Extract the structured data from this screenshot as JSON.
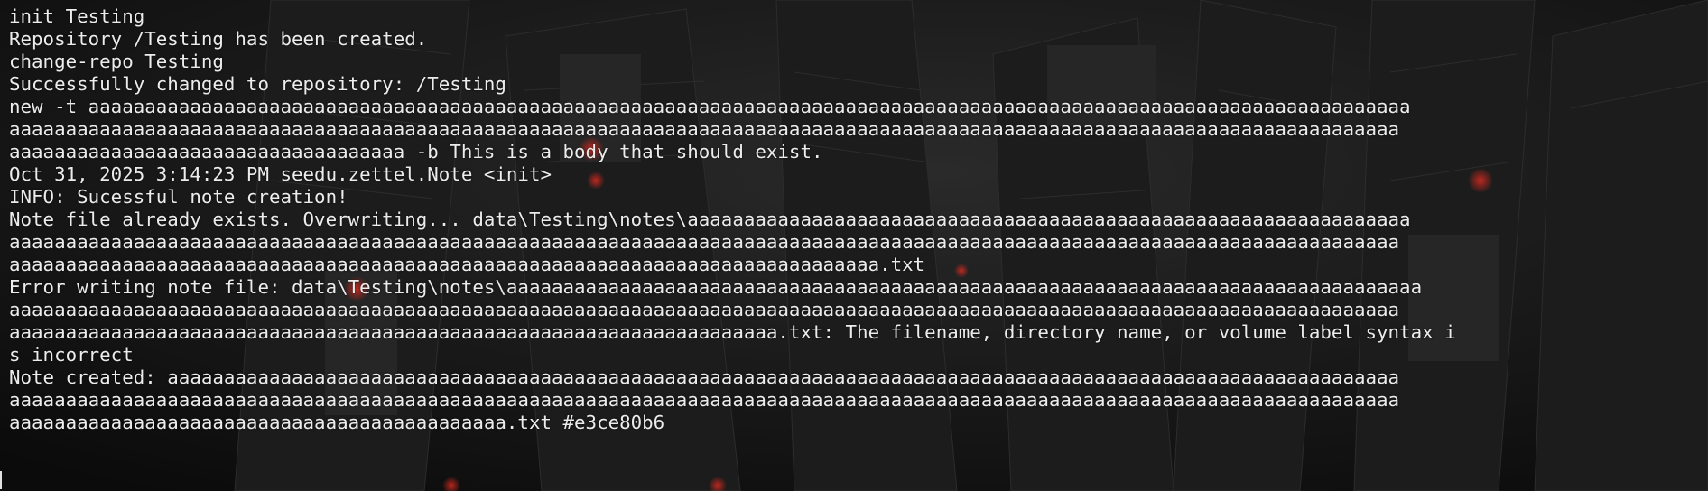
{
  "terminal": {
    "lines": [
      "init Testing",
      "Repository /Testing has been created.",
      "change-repo Testing",
      "Successfully changed to repository: /Testing",
      "new -t aaaaaaaaaaaaaaaaaaaaaaaaaaaaaaaaaaaaaaaaaaaaaaaaaaaaaaaaaaaaaaaaaaaaaaaaaaaaaaaaaaaaaaaaaaaaaaaaaaaaaaaaaaaaaaaaaaaaa",
      "aaaaaaaaaaaaaaaaaaaaaaaaaaaaaaaaaaaaaaaaaaaaaaaaaaaaaaaaaaaaaaaaaaaaaaaaaaaaaaaaaaaaaaaaaaaaaaaaaaaaaaaaaaaaaaaaaaaaaaaaaaa",
      "aaaaaaaaaaaaaaaaaaaaaaaaaaaaaaaaaaa -b This is a body that should exist.",
      "Oct 31, 2025 3:14:23 PM seedu.zettel.Note <init>",
      "INFO: Sucessful note creation!",
      "Note file already exists. Overwriting... data\\Testing\\notes\\aaaaaaaaaaaaaaaaaaaaaaaaaaaaaaaaaaaaaaaaaaaaaaaaaaaaaaaaaaaaaaaa",
      "aaaaaaaaaaaaaaaaaaaaaaaaaaaaaaaaaaaaaaaaaaaaaaaaaaaaaaaaaaaaaaaaaaaaaaaaaaaaaaaaaaaaaaaaaaaaaaaaaaaaaaaaaaaaaaaaaaaaaaaaaaa",
      "aaaaaaaaaaaaaaaaaaaaaaaaaaaaaaaaaaaaaaaaaaaaaaaaaaaaaaaaaaaaaaaaaaaaaaaaaaaaa.txt",
      "Error writing note file: data\\Testing\\notes\\aaaaaaaaaaaaaaaaaaaaaaaaaaaaaaaaaaaaaaaaaaaaaaaaaaaaaaaaaaaaaaaaaaaaaaaaaaaaaaaaa",
      "aaaaaaaaaaaaaaaaaaaaaaaaaaaaaaaaaaaaaaaaaaaaaaaaaaaaaaaaaaaaaaaaaaaaaaaaaaaaaaaaaaaaaaaaaaaaaaaaaaaaaaaaaaaaaaaaaaaaaaaaaaa",
      "aaaaaaaaaaaaaaaaaaaaaaaaaaaaaaaaaaaaaaaaaaaaaaaaaaaaaaaaaaaaaaaaaaaa.txt: The filename, directory name, or volume label syntax i",
      "s incorrect",
      "Note created: aaaaaaaaaaaaaaaaaaaaaaaaaaaaaaaaaaaaaaaaaaaaaaaaaaaaaaaaaaaaaaaaaaaaaaaaaaaaaaaaaaaaaaaaaaaaaaaaaaaaaaaaaaaaa",
      "aaaaaaaaaaaaaaaaaaaaaaaaaaaaaaaaaaaaaaaaaaaaaaaaaaaaaaaaaaaaaaaaaaaaaaaaaaaaaaaaaaaaaaaaaaaaaaaaaaaaaaaaaaaaaaaaaaaaaaaaaaa",
      "aaaaaaaaaaaaaaaaaaaaaaaaaaaaaaaaaaaaaaaaaaaa.txt #e3ce80b6"
    ]
  },
  "colors": {
    "text": "#ececec",
    "background": "#101010",
    "accent": "#c8281e"
  }
}
